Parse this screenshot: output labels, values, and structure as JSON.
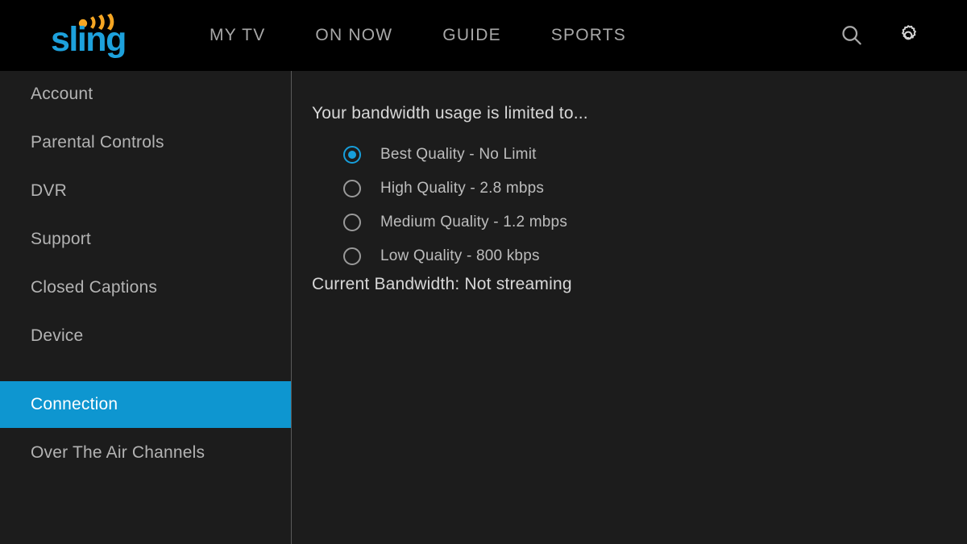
{
  "brand": {
    "name": "sling",
    "logo_color": "#1da1dc",
    "wave_color": "#f5a623"
  },
  "header": {
    "background": "#000000",
    "nav_items": [
      {
        "label": "MY TV"
      },
      {
        "label": "ON NOW"
      },
      {
        "label": "GUIDE"
      },
      {
        "label": "SPORTS"
      }
    ],
    "icons": [
      {
        "name": "search-icon"
      },
      {
        "name": "gear-icon"
      }
    ]
  },
  "sidebar": {
    "active_index": 7,
    "active_color": "#0e96d0",
    "items": [
      {
        "label": "Account"
      },
      {
        "label": "Parental Controls"
      },
      {
        "label": "DVR"
      },
      {
        "label": "Support"
      },
      {
        "label": "Closed Captions"
      },
      {
        "label": "Device"
      },
      {
        "label": "Connection"
      },
      {
        "label": "Over The Air Channels"
      }
    ]
  },
  "main": {
    "heading": "Your bandwidth usage is limited to...",
    "options": [
      {
        "label": "Best Quality - No Limit",
        "selected": true
      },
      {
        "label": "High Quality - 2.8 mbps",
        "selected": false
      },
      {
        "label": "Medium Quality - 1.2 mbps",
        "selected": false
      },
      {
        "label": "Low Quality - 800 kbps",
        "selected": false
      }
    ],
    "current_bandwidth": "Current Bandwidth: Not streaming",
    "selected_color": "#179fdb"
  }
}
